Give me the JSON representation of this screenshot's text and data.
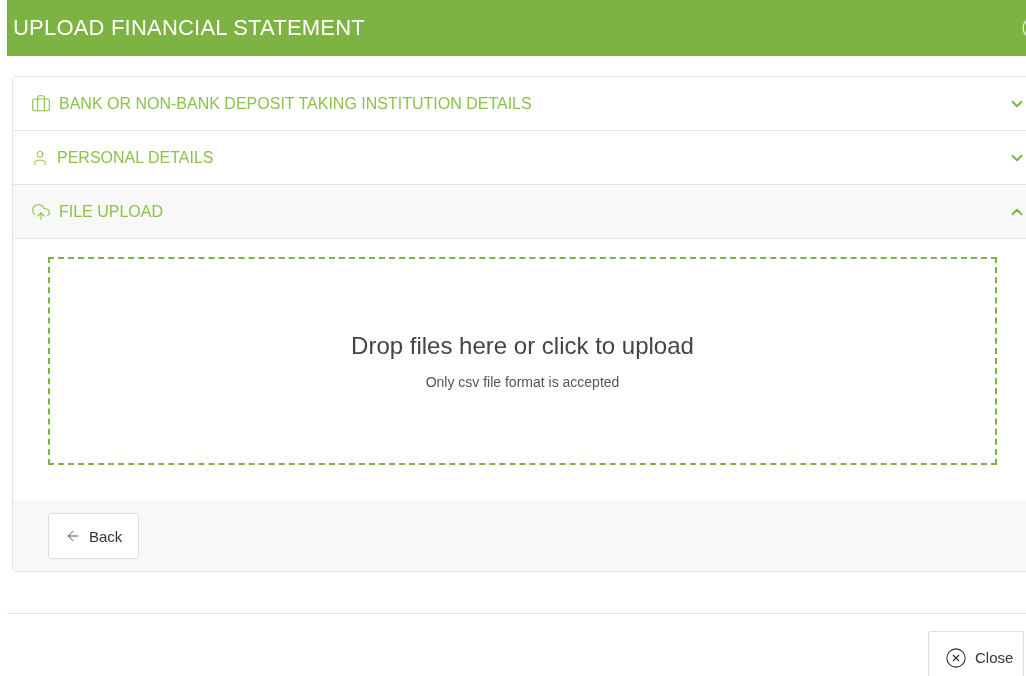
{
  "modal": {
    "title": "UPLOAD FINANCIAL STATEMENT"
  },
  "sections": [
    {
      "label": "BANK OR NON-BANK DEPOSIT TAKING INSTITUTION DETAILS",
      "kind": "bank",
      "expanded": false
    },
    {
      "label": "PERSONAL DETAILS",
      "kind": "person",
      "expanded": false
    },
    {
      "label": "FILE UPLOAD",
      "kind": "upload",
      "expanded": true
    }
  ],
  "dropzone": {
    "title": "Drop files here or click to upload",
    "hint": "Only csv file format is accepted"
  },
  "back_button": "Back",
  "close_button": "Close"
}
